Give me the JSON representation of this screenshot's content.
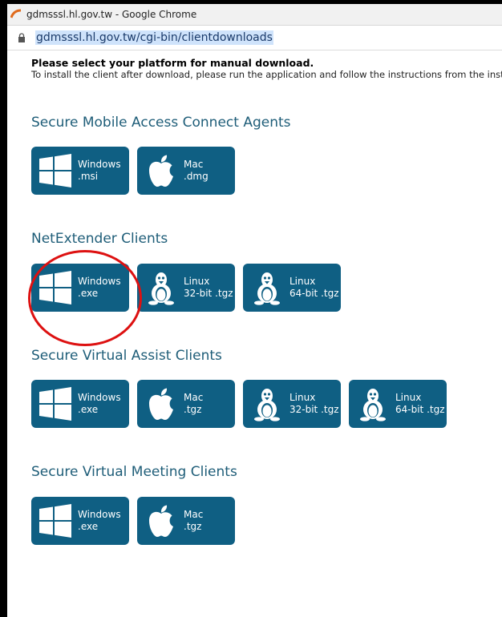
{
  "window": {
    "title": "gdmsssl.hl.gov.tw - Google Chrome"
  },
  "address_bar": {
    "url": "gdmsssl.hl.gov.tw/cgi-bin/clientdownloads"
  },
  "intro": {
    "heading": "Please select your platform for manual download.",
    "text": "To install the client after download, please run the application and follow the instructions from the inst"
  },
  "sections": [
    {
      "title": "Secure Mobile Access Connect Agents",
      "buttons": [
        {
          "line1": "Windows",
          "line2": ".msi",
          "icon": "windows-icon"
        },
        {
          "line1": "Mac",
          "line2": ".dmg",
          "icon": "apple-icon"
        }
      ]
    },
    {
      "title": "NetExtender Clients",
      "buttons": [
        {
          "line1": "Windows",
          "line2": ".exe",
          "icon": "windows-icon"
        },
        {
          "line1": "Linux",
          "line2": "32-bit .tgz",
          "icon": "linux-icon"
        },
        {
          "line1": "Linux",
          "line2": "64-bit .tgz",
          "icon": "linux-icon"
        }
      ]
    },
    {
      "title": "Secure Virtual Assist Clients",
      "buttons": [
        {
          "line1": "Windows",
          "line2": ".exe",
          "icon": "windows-icon"
        },
        {
          "line1": "Mac",
          "line2": ".tgz",
          "icon": "apple-icon"
        },
        {
          "line1": "Linux",
          "line2": "32-bit .tgz",
          "icon": "linux-icon"
        },
        {
          "line1": "Linux",
          "line2": "64-bit .tgz",
          "icon": "linux-icon"
        }
      ]
    },
    {
      "title": "Secure Virtual Meeting Clients",
      "buttons": [
        {
          "line1": "Windows",
          "line2": ".exe",
          "icon": "windows-icon"
        },
        {
          "line1": "Mac",
          "line2": ".tgz",
          "icon": "apple-icon"
        }
      ]
    }
  ],
  "colors": {
    "button_bg": "#0f5f83",
    "section_title": "#1e5d78",
    "highlight_circle": "#dd1111"
  }
}
